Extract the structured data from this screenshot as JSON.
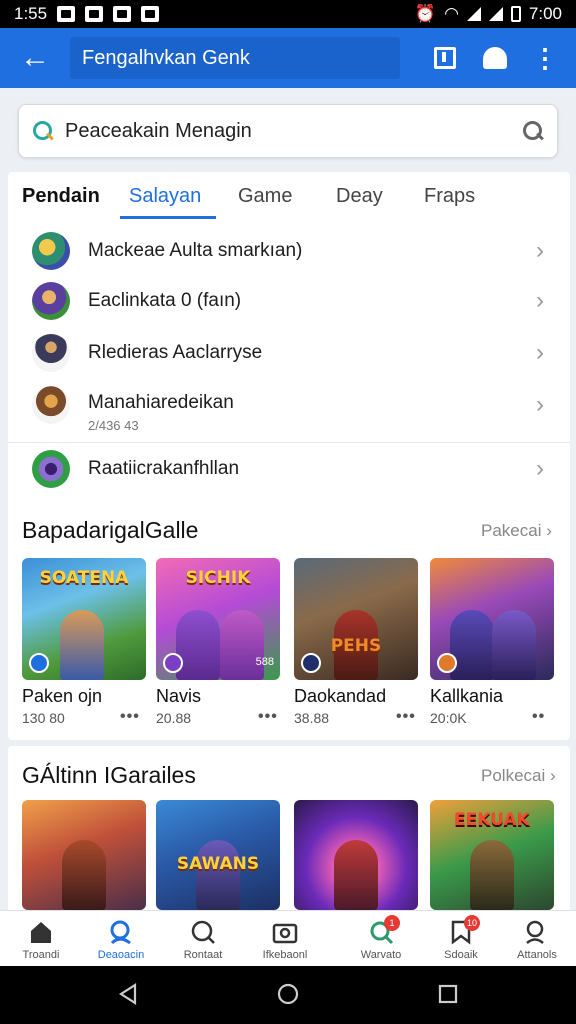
{
  "status_bar": {
    "time_left": "1:55",
    "time_right": "7:00"
  },
  "app_bar": {
    "title": "Fengalhvkan Genk"
  },
  "search": {
    "text": "Peaceakain Menagin"
  },
  "tabs": [
    "Pendain",
    "Salayan",
    "Game",
    "Deay",
    "Fraps"
  ],
  "list": [
    {
      "label": "Mackeae Aulta smarkıan)",
      "sub": ""
    },
    {
      "label": "Eaclinkata 0 (faın)",
      "sub": ""
    },
    {
      "label": "Rledieras Aaclarryse",
      "sub": ""
    },
    {
      "label": "Manahiaredeikan",
      "sub": "2/436 43"
    },
    {
      "label": "Raatiicrakanfhllan",
      "sub": ""
    }
  ],
  "section1": {
    "title": "BapadarigalGalle",
    "more": "Pakecai",
    "games": [
      {
        "art": "SOATENA",
        "name": "Paken ojn",
        "count": "130 80",
        "tile_count": ""
      },
      {
        "art": "SICHIK",
        "name": "Navis",
        "count": "20.88",
        "tile_count": "588"
      },
      {
        "art": "PEHS",
        "name": "Daokandad",
        "count": "38.88",
        "tile_count": ""
      },
      {
        "art": "",
        "name": "Kallkania",
        "count": "20:0K",
        "tile_count": ""
      }
    ]
  },
  "section2": {
    "title": "GÁltinn IGarailes",
    "more": "Polkecai",
    "games": [
      {
        "art": ""
      },
      {
        "art": "SAWANS"
      },
      {
        "art": ""
      },
      {
        "art": "EEKUAK"
      }
    ]
  },
  "bottom_nav": [
    {
      "label": "Troandi",
      "badge": ""
    },
    {
      "label": "Deaoacin",
      "badge": ""
    },
    {
      "label": "Rontaat",
      "badge": ""
    },
    {
      "label": "Ifkebaonl",
      "badge": ""
    },
    {
      "label": "Warvato",
      "badge": "1"
    },
    {
      "label": "Sdoaik",
      "badge": "10"
    },
    {
      "label": "Attanols",
      "badge": ""
    }
  ],
  "colors": {
    "accent": "#1f6fe0",
    "badge": "#e53935"
  }
}
